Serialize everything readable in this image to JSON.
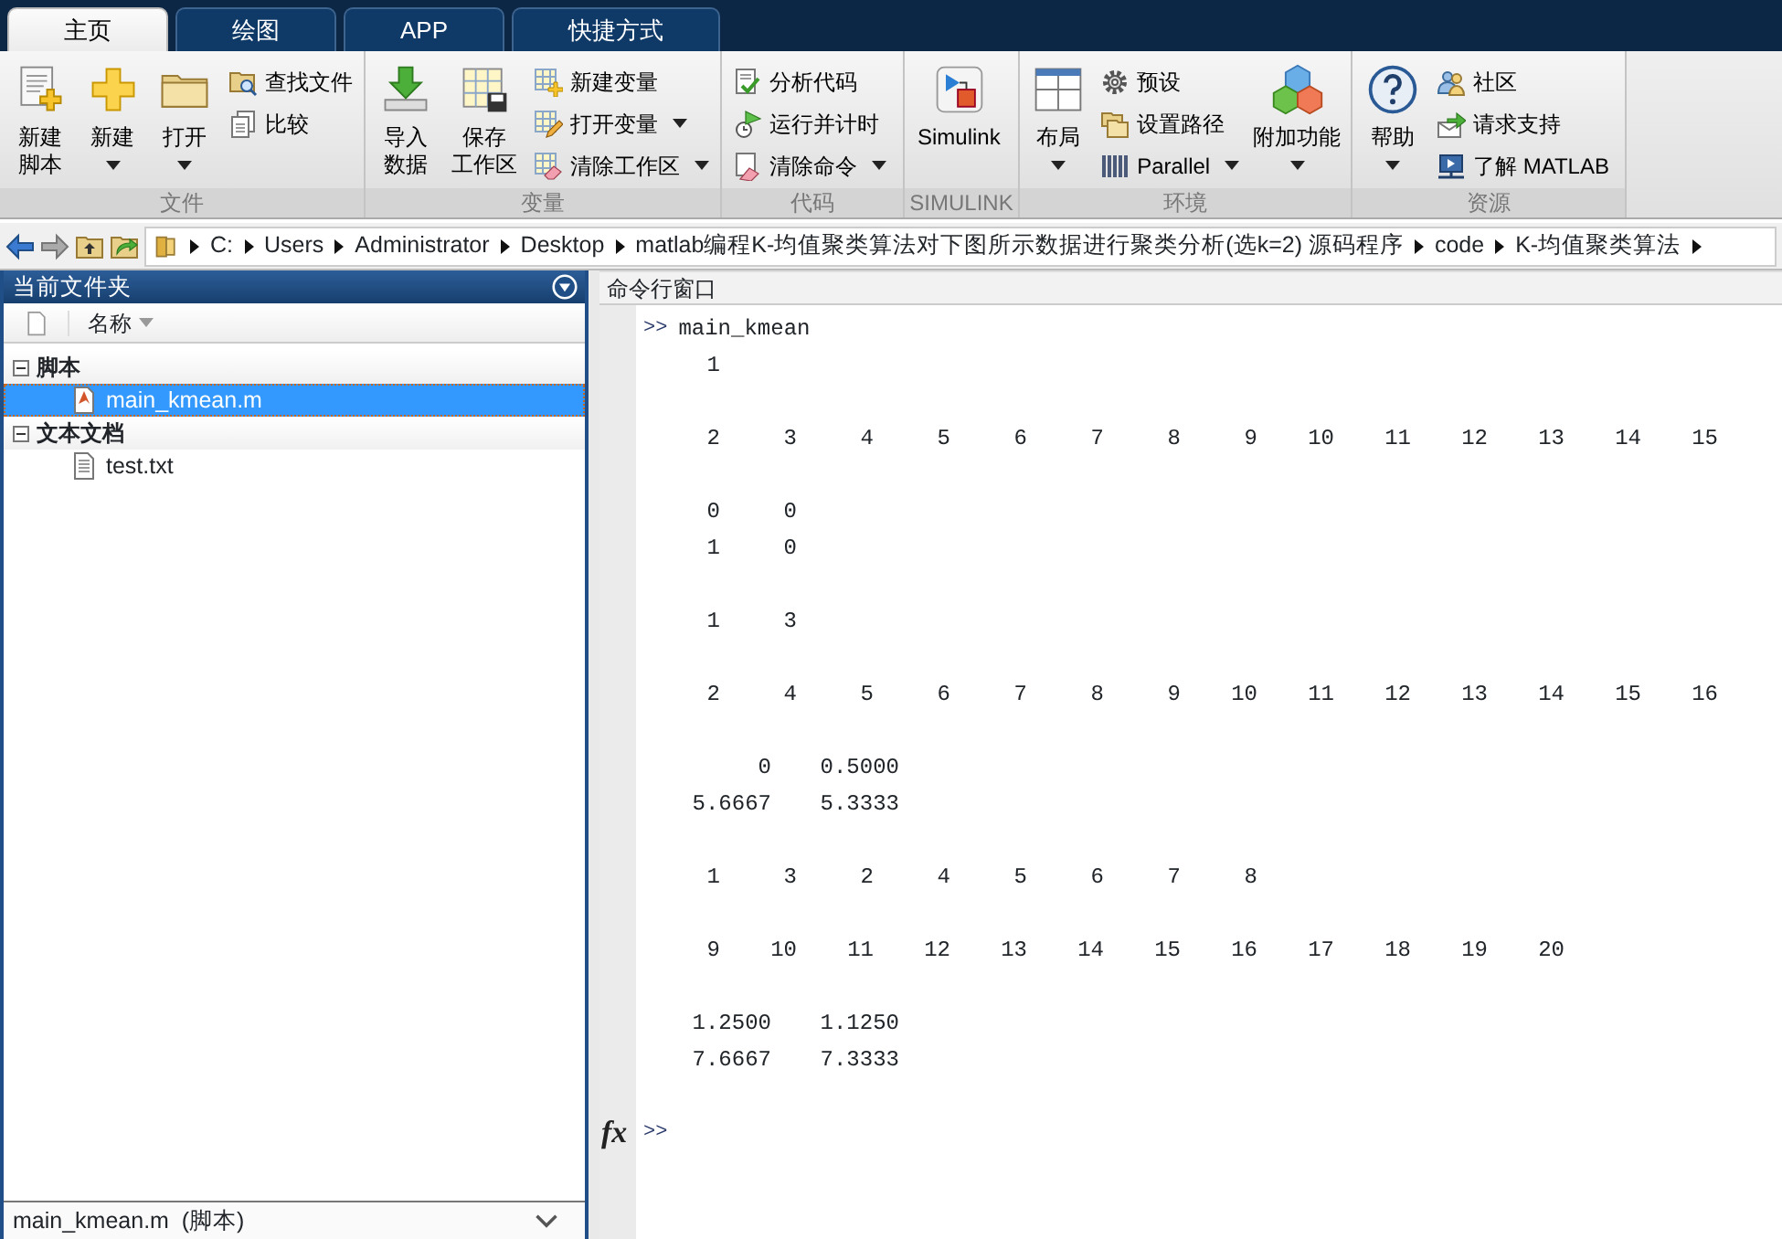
{
  "tabs": [
    {
      "label": "主页",
      "selected": true
    },
    {
      "label": "绘图",
      "selected": false
    },
    {
      "label": "APP",
      "selected": false
    },
    {
      "label": "快捷方式",
      "selected": false
    }
  ],
  "ribbon": {
    "sections": [
      {
        "title": "文件",
        "items": [
          {
            "kind": "large",
            "label_lines": [
              "新建",
              "脚本"
            ],
            "dropdown": false
          },
          {
            "kind": "large",
            "label_lines": [
              "新建"
            ],
            "dropdown": true
          },
          {
            "kind": "large",
            "label_lines": [
              "打开"
            ],
            "dropdown": true
          },
          {
            "kind": "column",
            "items": [
              {
                "label": "查找文件",
                "dropdown": false
              },
              {
                "label": "比较",
                "dropdown": false
              }
            ]
          }
        ]
      },
      {
        "title": "变量",
        "items": [
          {
            "kind": "large",
            "label_lines": [
              "导入",
              "数据"
            ],
            "dropdown": false
          },
          {
            "kind": "large",
            "label_lines": [
              "保存",
              "工作区"
            ],
            "dropdown": false
          },
          {
            "kind": "column",
            "items": [
              {
                "label": "新建变量",
                "dropdown": false
              },
              {
                "label": "打开变量",
                "dropdown": true
              },
              {
                "label": "清除工作区",
                "dropdown": true
              }
            ]
          }
        ]
      },
      {
        "title": "代码",
        "items": [
          {
            "kind": "column",
            "items": [
              {
                "label": "分析代码",
                "dropdown": false
              },
              {
                "label": "运行并计时",
                "dropdown": false
              },
              {
                "label": "清除命令",
                "dropdown": true
              }
            ]
          }
        ]
      },
      {
        "title": "SIMULINK",
        "items": [
          {
            "kind": "large",
            "label_lines": [
              "Simulink"
            ],
            "dropdown": false
          }
        ]
      },
      {
        "title": "环境",
        "items": [
          {
            "kind": "large",
            "label_lines": [
              "布局"
            ],
            "dropdown": true
          },
          {
            "kind": "column",
            "items": [
              {
                "label": "预设",
                "dropdown": false
              },
              {
                "label": "设置路径",
                "dropdown": false
              },
              {
                "label": "Parallel",
                "dropdown": true
              }
            ]
          },
          {
            "kind": "large",
            "label_lines": [
              "附加功能"
            ],
            "dropdown": true
          }
        ]
      },
      {
        "title": "资源",
        "items": [
          {
            "kind": "large",
            "label_lines": [
              "帮助"
            ],
            "dropdown": true
          },
          {
            "kind": "column",
            "items": [
              {
                "label": "社区",
                "dropdown": false
              },
              {
                "label": "请求支持",
                "dropdown": false
              },
              {
                "label": "了解 MATLAB",
                "dropdown": false
              }
            ]
          }
        ]
      }
    ]
  },
  "address_bar": {
    "path": [
      "C:",
      "Users",
      "Administrator",
      "Desktop",
      "matlab编程K-均值聚类算法对下图所示数据进行聚类分析(选k=2) 源码程序",
      "code",
      "K-均值聚类算法"
    ]
  },
  "current_folder": {
    "title": "当前文件夹",
    "column_header": "名称",
    "groups": [
      {
        "label": "脚本",
        "expanded": true,
        "children": [
          {
            "label": "main_kmean.m",
            "kind": "script",
            "selected": true
          }
        ]
      },
      {
        "label": "文本文档",
        "expanded": true,
        "children": [
          {
            "label": "test.txt",
            "kind": "text",
            "selected": false
          }
        ]
      }
    ],
    "status": "main_kmean.m  (脚本)"
  },
  "command_window": {
    "title": "命令行窗口",
    "prompt": ">>",
    "command": "main_kmean",
    "blocks": [
      {
        "kind": "integer",
        "rows": [
          [
            "1"
          ]
        ]
      },
      {
        "kind": "integer",
        "rows": [
          [
            "2",
            "3",
            "4",
            "5",
            "6",
            "7",
            "8",
            "9",
            "10",
            "11",
            "12",
            "13",
            "14",
            "15"
          ]
        ]
      },
      {
        "kind": "integer",
        "rows": [
          [
            "0",
            "0"
          ],
          [
            "1",
            "0"
          ]
        ]
      },
      {
        "kind": "integer",
        "rows": [
          [
            "1",
            "3"
          ]
        ]
      },
      {
        "kind": "integer",
        "rows": [
          [
            "2",
            "4",
            "5",
            "6",
            "7",
            "8",
            "9",
            "10",
            "11",
            "12",
            "13",
            "14",
            "15",
            "16"
          ]
        ]
      },
      {
        "kind": "decimal",
        "rows": [
          [
            "0",
            "0.5000"
          ],
          [
            "5.6667",
            "5.3333"
          ]
        ]
      },
      {
        "kind": "integer",
        "rows": [
          [
            "1",
            "3",
            "2",
            "4",
            "5",
            "6",
            "7",
            "8"
          ]
        ]
      },
      {
        "kind": "integer",
        "rows": [
          [
            "9",
            "10",
            "11",
            "12",
            "13",
            "14",
            "15",
            "16",
            "17",
            "18",
            "19",
            "20"
          ]
        ]
      },
      {
        "kind": "decimal",
        "rows": [
          [
            "1.2500",
            "1.1250"
          ],
          [
            "7.6667",
            "7.3333"
          ]
        ]
      }
    ],
    "function_button": "fx",
    "input_prompt": ">>"
  }
}
